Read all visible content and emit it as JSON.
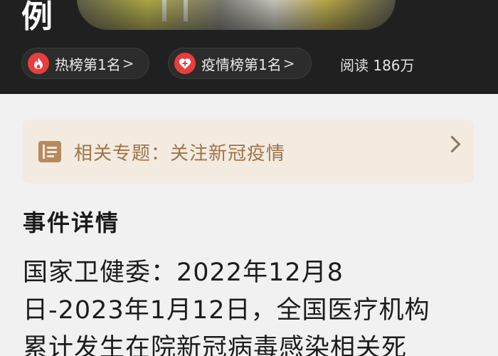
{
  "header": {
    "title_fragment": "例",
    "chips": [
      {
        "label": "热榜第1名",
        "icon": "flame-icon"
      },
      {
        "label": "疫情榜第1名",
        "icon": "heart-plus-icon"
      }
    ],
    "read_label": "阅读",
    "read_count": "186万"
  },
  "topic": {
    "label": "相关专题：关注新冠疫情",
    "icon": "topic-icon"
  },
  "details": {
    "heading": "事件详情",
    "lines": [
      "国家卫健委：2022年12月8",
      "日-2023年1月12日，全国医疗机构",
      "累计发生在院新冠病毒感染相关死"
    ]
  },
  "colors": {
    "header_bg": "#202020",
    "chip_icon": "#ea3d3d",
    "topic_bg": "#f3ebe0",
    "topic_text": "#a07349"
  }
}
